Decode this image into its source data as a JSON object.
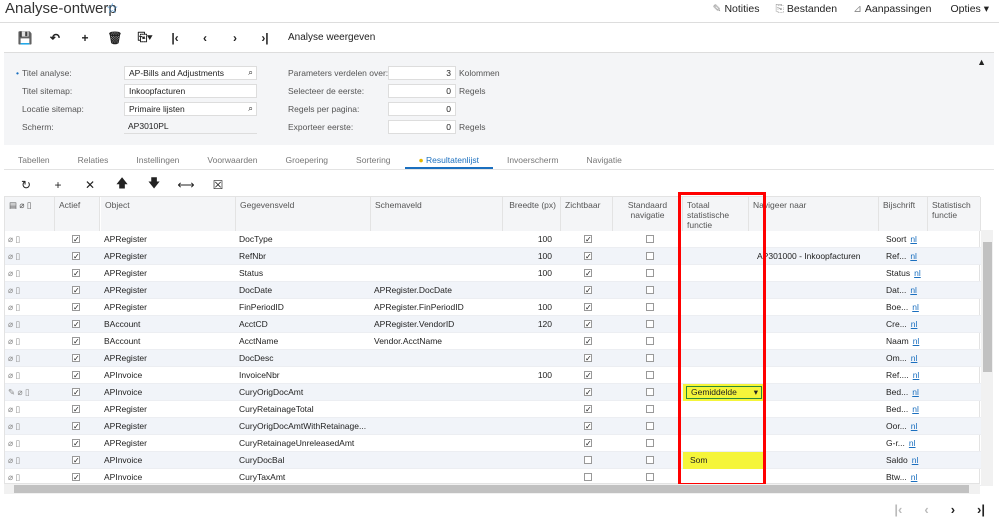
{
  "page": {
    "title": "Analyse-ontwerp",
    "star_icon": "star-icon"
  },
  "toplinks": [
    {
      "icon": "✎",
      "label": "Notities"
    },
    {
      "icon": "⎘",
      "label": "Bestanden"
    },
    {
      "icon": "⊿",
      "label": "Aanpassingen"
    },
    {
      "icon": "",
      "label": "Opties ▾"
    }
  ],
  "toolbar": {
    "icons": [
      "💾",
      "↶",
      "+",
      "🗑",
      "⎘▾",
      "|‹",
      "‹",
      "›",
      "›|"
    ],
    "view_label": "Analyse weergeven"
  },
  "form": {
    "left": [
      {
        "label": "Titel analyse:",
        "value": "AP-Bills and Adjustments",
        "required": true,
        "lookup": true
      },
      {
        "label": "Titel sitemap:",
        "value": "Inkoopfacturen"
      },
      {
        "label": "Locatie sitemap:",
        "value": "Primaire lijsten",
        "lookup": true
      },
      {
        "label": "Scherm:",
        "value": "AP3010PL",
        "readonly": true
      }
    ],
    "right": [
      {
        "label": "Parameters verdelen over:",
        "value": "3",
        "unit": "Kolommen"
      },
      {
        "label": "Selecteer de eerste:",
        "value": "0",
        "unit": "Regels"
      },
      {
        "label": "Regels per pagina:",
        "value": "0",
        "unit": ""
      },
      {
        "label": "Exporteer eerste:",
        "value": "0",
        "unit": "Regels"
      }
    ]
  },
  "tabs": [
    "Tabellen",
    "Relaties",
    "Instellingen",
    "Voorwaarden",
    "Groepering",
    "Sortering",
    "Resultatenlijst",
    "Invoerscherm",
    "Navigatie"
  ],
  "active_tab": "Resultatenlijst",
  "grid_toolbar": [
    "↻",
    "+",
    "✕",
    "🡅",
    "🡇",
    "⟷",
    "☒"
  ],
  "columns": [
    "Actief",
    "Object",
    "Gegevensveld",
    "Schemaveld",
    "Breedte (px)",
    "Zichtbaar",
    "Standaard navigatie",
    "Totaal statistische functie",
    "Navigeer naar",
    "Bijschrift",
    "Statistisch functie"
  ],
  "rows": [
    [
      "APRegister",
      "DocType",
      "",
      "100",
      true,
      "",
      "",
      "Soort"
    ],
    [
      "APRegister",
      "RefNbr",
      "",
      "100",
      true,
      "",
      "AP301000 - Inkoopfacturen",
      "Ref..."
    ],
    [
      "APRegister",
      "Status",
      "",
      "100",
      true,
      "",
      "",
      "Status"
    ],
    [
      "APRegister",
      "DocDate",
      "APRegister.DocDate",
      "",
      true,
      "",
      "",
      "Dat..."
    ],
    [
      "APRegister",
      "FinPeriodID",
      "APRegister.FinPeriodID",
      "100",
      true,
      "",
      "",
      "Boe..."
    ],
    [
      "BAccount",
      "AcctCD",
      "APRegister.VendorID",
      "120",
      true,
      "",
      "",
      "Cre..."
    ],
    [
      "BAccount",
      "AcctName",
      "Vendor.AcctName",
      "",
      true,
      "",
      "",
      "Naam"
    ],
    [
      "APRegister",
      "DocDesc",
      "",
      "",
      true,
      "",
      "",
      "Om..."
    ],
    [
      "APInvoice",
      "InvoiceNbr",
      "",
      "100",
      true,
      "",
      "",
      "Ref...."
    ],
    [
      "APInvoice",
      "CuryOrigDocAmt",
      "",
      "",
      true,
      "Gemiddelde",
      "",
      "Bed..."
    ],
    [
      "APRegister",
      "CuryRetainageTotal",
      "",
      "",
      true,
      "",
      "",
      "Bed..."
    ],
    [
      "APRegister",
      "CuryOrigDocAmtWithRetainage...",
      "",
      "",
      true,
      "",
      "",
      "Oor..."
    ],
    [
      "APRegister",
      "CuryRetainageUnreleasedAmt",
      "",
      "",
      true,
      "",
      "",
      "G-r..."
    ],
    [
      "APInvoice",
      "CuryDocBal",
      "",
      "",
      false,
      "Som",
      "",
      "Saldo"
    ],
    [
      "APInvoice",
      "CuryTaxAmt",
      "",
      "",
      false,
      "",
      "",
      "Btw..."
    ]
  ],
  "lang_link": "nl",
  "pager": [
    "|‹",
    "‹",
    "›",
    "›|"
  ],
  "colors": {
    "accent": "#1a6fbf",
    "highlight": "#f5f53a",
    "annotation": "#ff0000"
  }
}
